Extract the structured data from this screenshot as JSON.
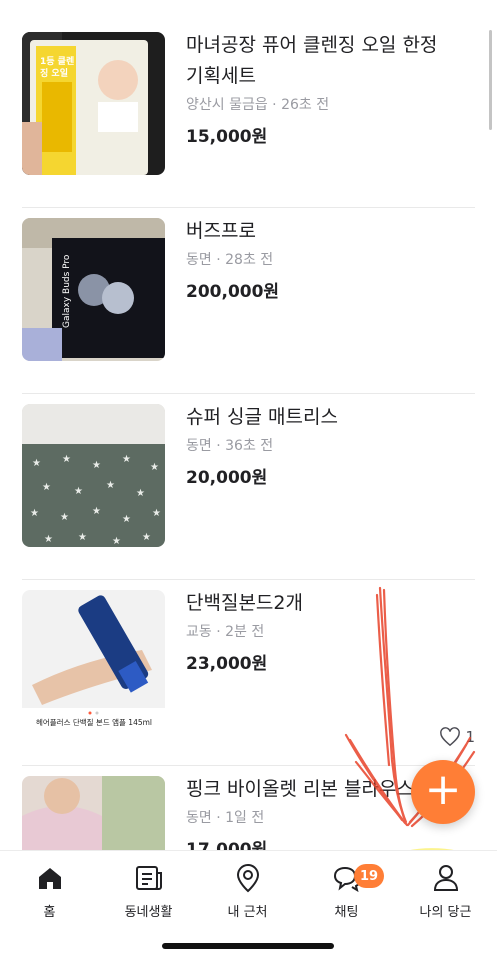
{
  "items": [
    {
      "title": "마녀공장 퓨어 클렌징 오일 한정 기획세트",
      "location": "양산시 물금읍",
      "time": "26초 전",
      "price": "15,000원",
      "thumb_text": "1등 클렌징 오일"
    },
    {
      "title": "버즈프로",
      "location": "동면",
      "time": "28초 전",
      "price": "200,000원",
      "thumb_text": "Galaxy Buds Pro"
    },
    {
      "title": "슈퍼 싱글 매트리스",
      "location": "동면",
      "time": "36초 전",
      "price": "20,000원"
    },
    {
      "title": "단백질본드2개",
      "location": "교동",
      "time": "2분 전",
      "price": "23,000원",
      "likes": "1",
      "thumb_caption": "헤어플러스 단백질 본드 앰플 145ml"
    },
    {
      "title": "핑크 바이올렛 리본 블라우스",
      "location": "동면",
      "time": "1일 전",
      "price": "17,000원"
    }
  ],
  "meta_separator": " · ",
  "fab": {
    "label": "+",
    "color": "#ff7e36"
  },
  "tabs": [
    {
      "label": "홈",
      "icon": "home-icon"
    },
    {
      "label": "동네생활",
      "icon": "community-icon"
    },
    {
      "label": "내 근처",
      "icon": "location-pin-icon"
    },
    {
      "label": "채팅",
      "icon": "chat-icon",
      "badge": "19"
    },
    {
      "label": "나의 당근",
      "icon": "profile-icon"
    }
  ],
  "colors": {
    "accent": "#ff7e36",
    "text": "#212124",
    "meta": "#9a9ba2",
    "annotation_red": "#e8432a",
    "annotation_yellow": "#fbf27a"
  }
}
